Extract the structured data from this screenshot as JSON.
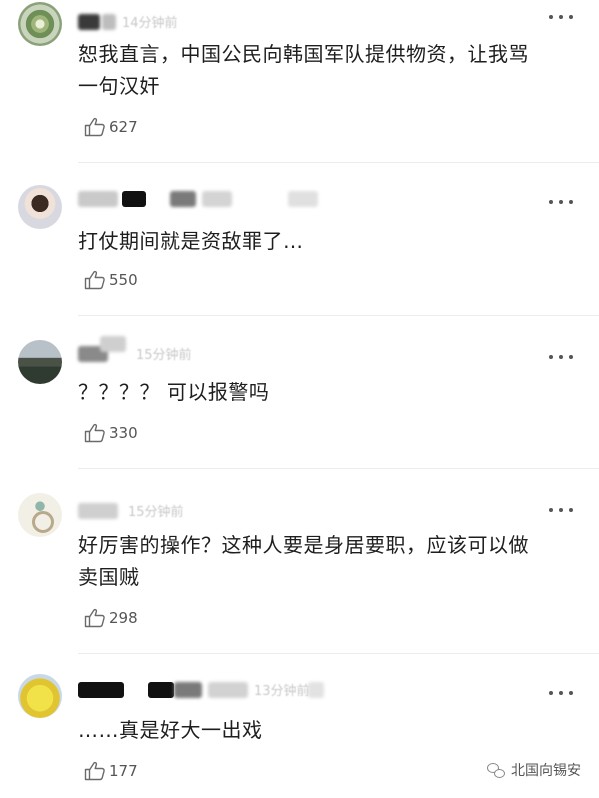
{
  "comments": [
    {
      "time": "14分钟前",
      "text": [
        "恕我直言，中国公民向韩国军队提供物资，让我骂",
        "一句汉奸"
      ],
      "likes": "627"
    },
    {
      "time": "",
      "text": [
        "打仗期间就是资敌罪了…"
      ],
      "likes": "550"
    },
    {
      "time": "15分钟前",
      "text": [
        "？？？？ 可以报警吗"
      ],
      "likes": "330"
    },
    {
      "time": "15分钟前",
      "text": [
        "好厉害的操作？这种人要是身居要职，应该可以做",
        "卖国贼"
      ],
      "likes": "298"
    },
    {
      "time": "13分钟前",
      "text": [
        "……真是好大一出戏"
      ],
      "likes": "177"
    }
  ],
  "watermark": {
    "text": "北国向锡安"
  }
}
